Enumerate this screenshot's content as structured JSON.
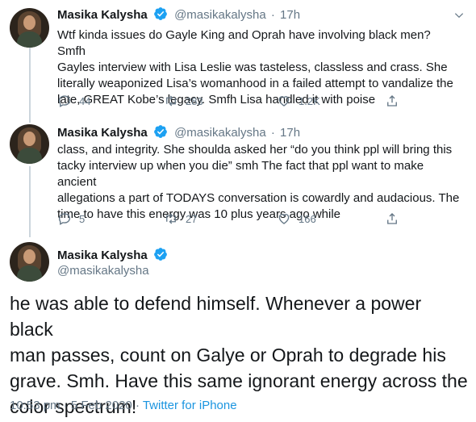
{
  "tweets": [
    {
      "display_name": "Masika Kalysha",
      "handle": "@masikakalysha",
      "dot": "·",
      "time": "17h",
      "lines": [
        "Wtf kinda issues do Gayle King and Oprah have involving black men? Smfh",
        "Gayles interview with Lisa Leslie was tasteless, classless and crass. She",
        "literally weaponized Lisa’s womanhood in a failed attempt to vandalize the",
        "late, GREAT Kobe’s legacy. Smfh Lisa handled it with poise"
      ],
      "replies": "44",
      "retweets": "283",
      "likes": "1.2K"
    },
    {
      "display_name": "Masika Kalysha",
      "handle": "@masikakalysha",
      "dot": "·",
      "time": "17h",
      "lines": [
        "class, and integrity. She shoulda asked her “do you think ppl will bring this",
        "tacky interview up when you die” smh The fact that ppl want to make ancient",
        "allegations a part of TODAYS conversation is cowardly and audacious. The",
        "time to have this energy was 10 plus years ago while"
      ],
      "replies": "5",
      "retweets": "27",
      "likes": "166"
    }
  ],
  "main_tweet": {
    "display_name": "Masika Kalysha",
    "handle": "@masikakalysha",
    "lines": [
      "he was able to defend himself. Whenever a power black",
      "man passes, count on Galye or Oprah to degrade his",
      "grave. Smh. Have this same ignorant energy across the",
      "color spectrum!"
    ],
    "timestamp": "10:53 pm · 5 Feb 2020",
    "separator": "·",
    "source": "Twitter for iPhone"
  },
  "colors": {
    "accent": "#1da1f2",
    "muted": "#657786",
    "text": "#14171a",
    "link": "#1b95e0"
  },
  "icons": [
    "reply-icon",
    "retweet-icon",
    "like-icon",
    "share-icon",
    "verified-badge-icon",
    "chevron-down-icon"
  ]
}
